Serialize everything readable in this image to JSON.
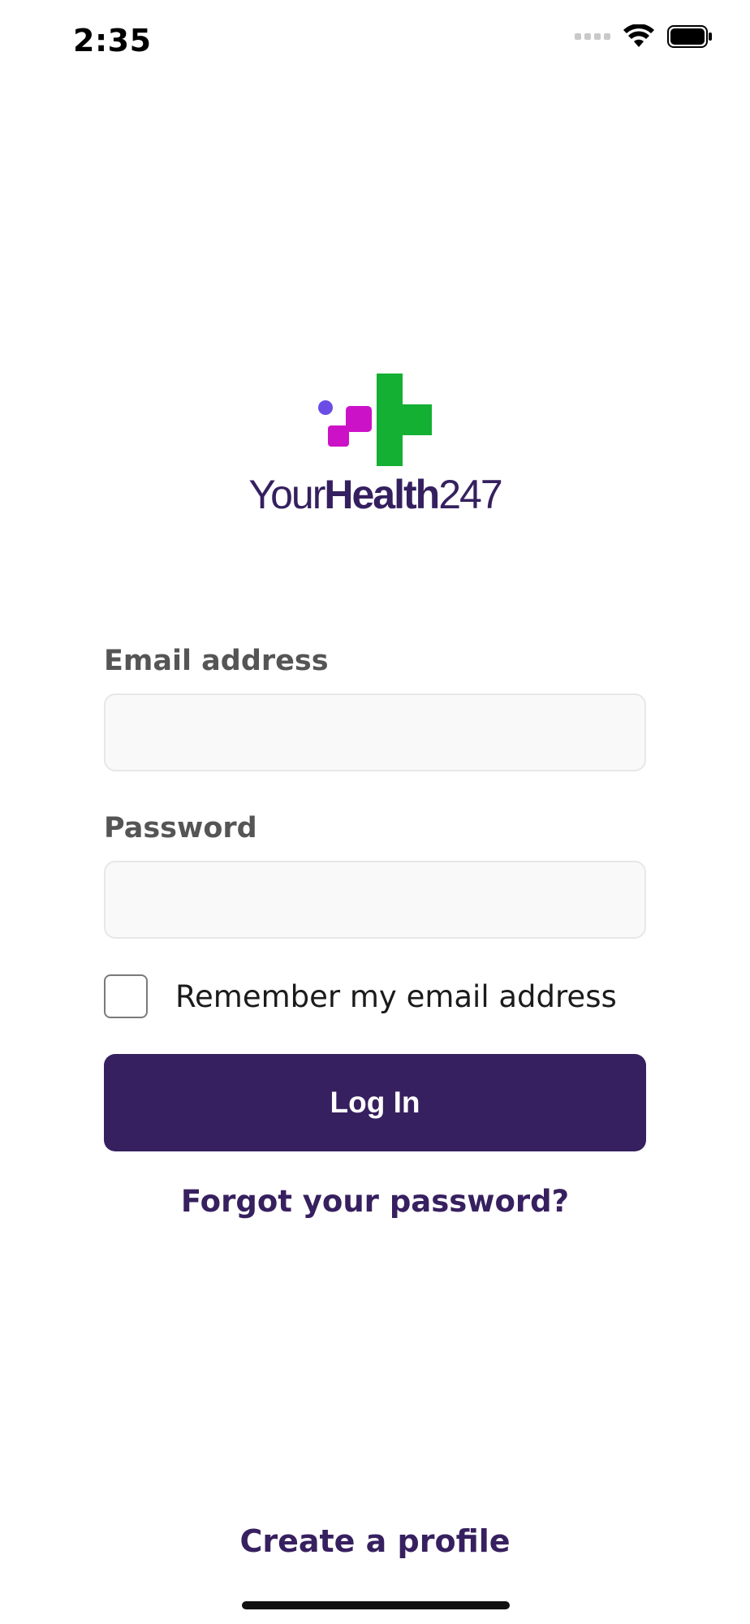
{
  "status_bar": {
    "time": "2:35",
    "icons": [
      "signal-dots-icon",
      "wifi-icon",
      "battery-icon"
    ]
  },
  "logo": {
    "word_light": "Your",
    "word_bold": "Health",
    "word_number": "247",
    "colors": {
      "dot": "#6b4de6",
      "magenta": "#cc12c7",
      "green": "#13b033",
      "text": "#35205f"
    }
  },
  "form": {
    "email_label": "Email address",
    "email_value": "",
    "email_placeholder": "",
    "password_label": "Password",
    "password_value": "",
    "password_placeholder": "",
    "remember_label": "Remember my email address",
    "remember_checked": false,
    "login_label": "Log In",
    "forgot_link": "Forgot your password?"
  },
  "footer": {
    "create_profile": "Create a profile"
  },
  "theme": {
    "primary": "#37205f",
    "label_gray": "#555555",
    "input_bg": "#f9f9f9",
    "input_border": "#e7e7e7"
  }
}
